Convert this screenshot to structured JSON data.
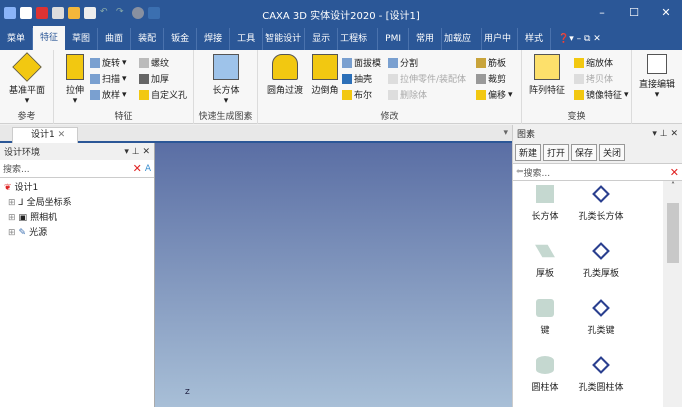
{
  "title": "CAXA 3D 实体设计2020 - [设计1]",
  "tabs": [
    "菜单",
    "特征",
    "草图",
    "曲面",
    "装配",
    "钣金",
    "焊接",
    "工具",
    "智能设计",
    "显示",
    "工程标注",
    "PMI",
    "常用",
    "加载应用",
    "用户中心",
    "样式"
  ],
  "ribbon": {
    "ref": {
      "label": "参考",
      "items": [
        "基准平面"
      ]
    },
    "feature": {
      "label": "特征",
      "big": "拉伸",
      "items": [
        "旋转",
        "扫描",
        "放样",
        "螺纹",
        "加厚",
        "自定义孔"
      ]
    },
    "quick": {
      "label": "快速生成图素",
      "big": "长方体"
    },
    "modify": {
      "label": "修改",
      "big": [
        "圆角过渡",
        "边倒角"
      ],
      "items": [
        "面拔模",
        "抽壳",
        "布尔",
        "分割",
        "拉伸零件/装配体",
        "删除体",
        "筋板",
        "裁剪",
        "偏移"
      ]
    },
    "transform": {
      "label": "变换",
      "big": "阵列特征",
      "items": [
        "缩放体",
        "拷贝体",
        "镜像特征"
      ]
    },
    "direct": {
      "big": "直接编辑"
    }
  },
  "doc_tab": "设计1",
  "left": {
    "title": "设计环境",
    "search": "搜索...",
    "tree": [
      "设计1",
      "全局坐标系",
      "照相机",
      "光源"
    ]
  },
  "right": {
    "title": "图素",
    "buttons": [
      "新建",
      "打开",
      "保存",
      "关闭"
    ],
    "search": "搜索...",
    "items": [
      "长方体",
      "孔类长方体",
      "厚板",
      "孔类厚板",
      "键",
      "孔类键",
      "圆柱体",
      "孔类圆柱体"
    ]
  },
  "axis_label": "Z"
}
